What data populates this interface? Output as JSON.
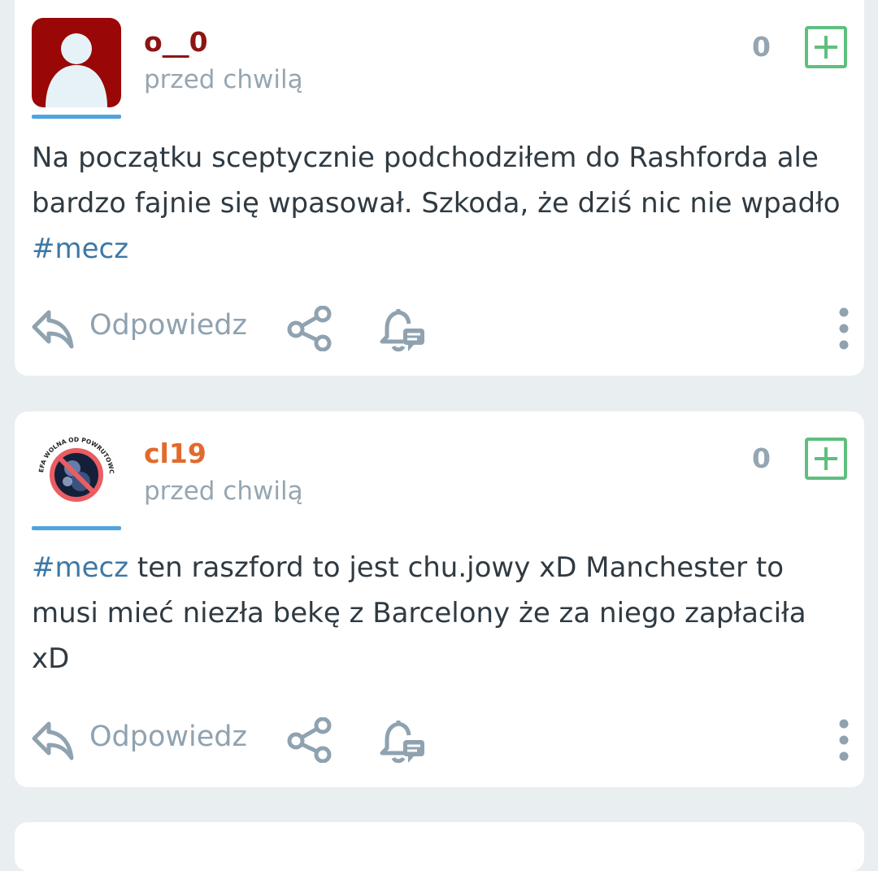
{
  "posts": [
    {
      "username": "o__0",
      "timestamp": "przed chwilą",
      "votes": "0",
      "content_parts": {
        "text": "Na początku sceptycznie podchodziłem do Rashforda ale bardzo fajnie się wpasował. Szkoda, że dziś nic nie wpadło ",
        "tag": "#mecz",
        "after": ""
      },
      "avatar_icon": "default-user-avatar",
      "reply_label": "Odpowiedz"
    },
    {
      "username": "cl19",
      "timestamp": "przed chwilą",
      "votes": "0",
      "content_parts": {
        "text": "",
        "tag": "#mecz",
        "after": " ten raszford to jest chu.jowy xD Manchester to musi mieć niezła bekę z Barcelony że za niego zapłaciła xD"
      },
      "avatar_icon": "badge-avatar",
      "avatar_badge_text": "STREFA WOLNA OD POWRUTOWCÓW",
      "reply_label": "Odpowiedz"
    }
  ],
  "colors": {
    "background": "#e9eef1",
    "user1": "#8e1414",
    "user2": "#e26a2c",
    "tag": "#3d78a6",
    "plus": "#5fbf7f",
    "muted": "#96a6b2"
  },
  "icons": [
    "reply-icon",
    "share-icon",
    "bell-comment-icon",
    "more-vertical-icon",
    "plus-icon"
  ]
}
